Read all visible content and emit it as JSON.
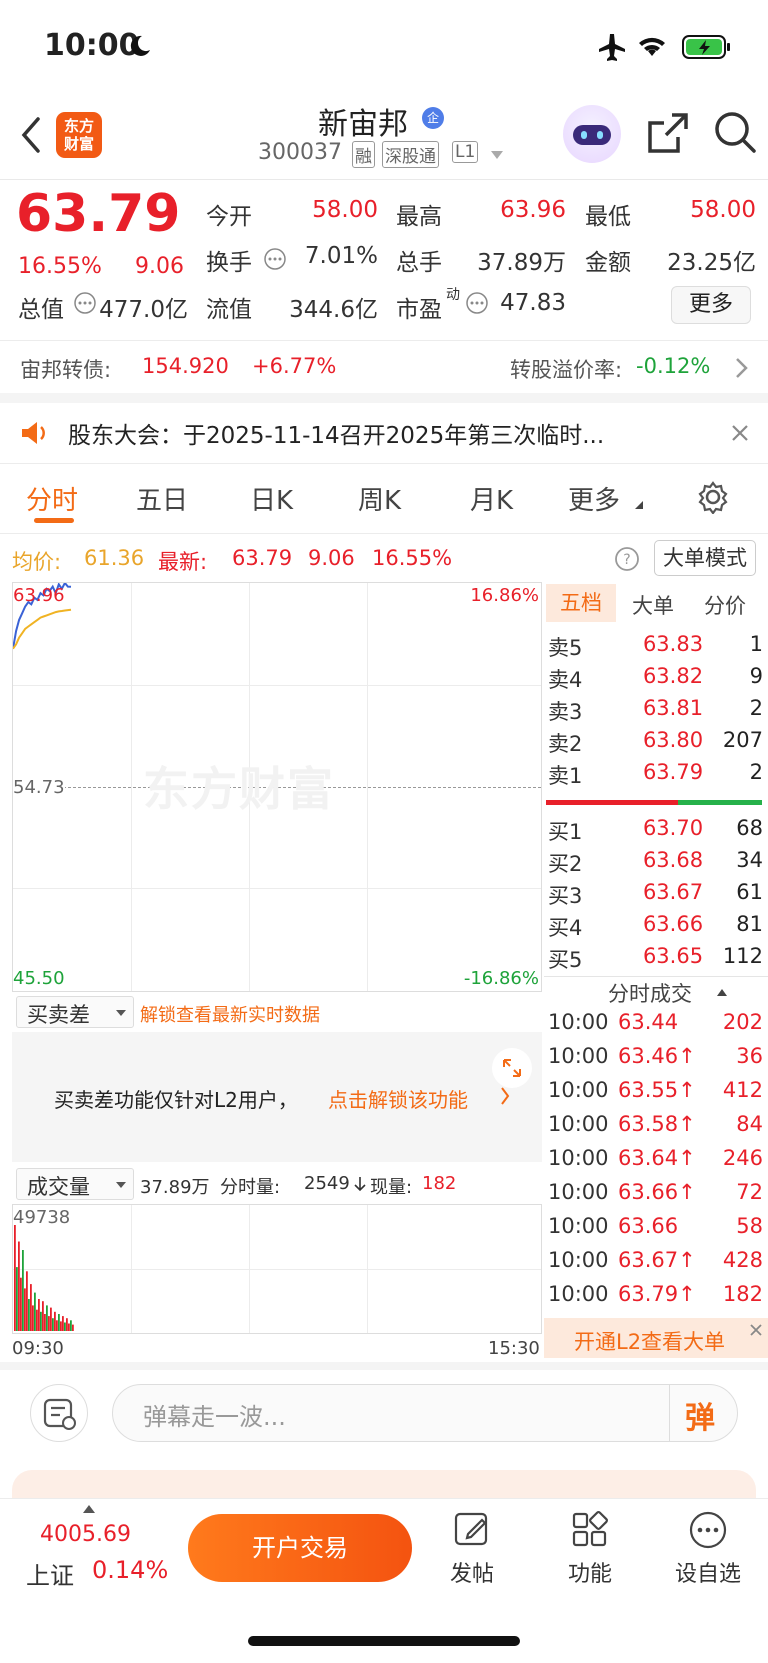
{
  "status": {
    "time": "10:00"
  },
  "header": {
    "logo_line1": "东方",
    "logo_line2": "财富",
    "stock_name": "新宙邦",
    "badge": "企",
    "code": "300037",
    "tag1": "融",
    "tag2": "深股通",
    "tag3": "L1"
  },
  "quote": {
    "price": "63.79",
    "pct": "16.55%",
    "change": "9.06",
    "open_label": "今开",
    "open": "58.00",
    "high_label": "最高",
    "high": "63.96",
    "low_label": "最低",
    "low": "58.00",
    "turnover_label": "换手",
    "turnover": "7.01%",
    "vol_label": "总手",
    "vol": "37.89万",
    "amount_label": "金额",
    "amount": "23.25亿",
    "mcap_label": "总值",
    "mcap": "477.0亿",
    "float_label": "流值",
    "float": "344.6亿",
    "pe_label": "市盈",
    "pe_sup": "动",
    "pe": "47.83",
    "more": "更多"
  },
  "bond": {
    "label": "宙邦转债:",
    "price": "154.920",
    "pct": "+6.77%",
    "premium_label": "转股溢价率:",
    "premium": "-0.12%"
  },
  "notice": {
    "text": "股东大会：于2025-11-14召开2025年第三次临时..."
  },
  "tabs": [
    "分时",
    "五日",
    "日K",
    "周K",
    "月K",
    "更多"
  ],
  "chart_header": {
    "avg_label": "均价:",
    "avg": "61.36",
    "latest_label": "最新:",
    "latest": "63.79",
    "chg": "9.06",
    "pct": "16.55%",
    "mode": "大单模式"
  },
  "chart_axis": {
    "top": "63.96",
    "mid": "54.73",
    "bottom": "45.50",
    "top_pct": "16.86%",
    "bottom_pct": "-16.86%",
    "watermark": "东方财富",
    "time_start": "09:30",
    "time_end": "15:30"
  },
  "chart_data": {
    "type": "line",
    "series": [
      {
        "values": [
          61.0,
          61.8,
          62.3,
          62.6,
          62.9,
          63.1,
          63.0,
          63.3,
          63.2,
          63.5,
          63.4,
          63.7,
          63.6,
          63.8,
          63.5,
          63.9,
          63.7,
          63.96,
          63.8,
          63.79
        ]
      },
      {
        "values": [
          61.0,
          61.2,
          61.5,
          61.7,
          61.9,
          62.0,
          62.1,
          62.2,
          62.3,
          62.4,
          62.45,
          62.5,
          62.55,
          62.6,
          62.65,
          62.68,
          62.7,
          62.72,
          62.74,
          62.76
        ]
      }
    ],
    "ylim": [
      45.5,
      63.96
    ]
  },
  "volume_data": {
    "max_label": "49738",
    "bars": [
      49738,
      30000,
      42000,
      25000,
      38000,
      20000,
      28000,
      15000,
      22000,
      12000,
      18000,
      10000,
      15000,
      9000,
      14000,
      8000,
      12000,
      7000,
      11000,
      6000,
      9000,
      5000,
      8000,
      4500,
      7000,
      4000,
      6000,
      3500,
      5000,
      3000
    ]
  },
  "bidask_tabs": [
    "五档",
    "大单",
    "分价"
  ],
  "sells": [
    {
      "label": "卖5",
      "price": "63.83",
      "vol": "1"
    },
    {
      "label": "卖4",
      "price": "63.82",
      "vol": "9"
    },
    {
      "label": "卖3",
      "price": "63.81",
      "vol": "2"
    },
    {
      "label": "卖2",
      "price": "63.80",
      "vol": "207"
    },
    {
      "label": "卖1",
      "price": "63.79",
      "vol": "2"
    }
  ],
  "buys": [
    {
      "label": "买1",
      "price": "63.70",
      "vol": "68"
    },
    {
      "label": "买2",
      "price": "63.68",
      "vol": "34"
    },
    {
      "label": "买3",
      "price": "63.67",
      "vol": "61"
    },
    {
      "label": "买4",
      "price": "63.66",
      "vol": "81"
    },
    {
      "label": "买5",
      "price": "63.65",
      "vol": "112"
    }
  ],
  "trades_title": "分时成交",
  "trades": [
    {
      "t": "10:00",
      "p": "63.44",
      "v": "202"
    },
    {
      "t": "10:00",
      "p": "63.46↑",
      "v": "36"
    },
    {
      "t": "10:00",
      "p": "63.55↑",
      "v": "412"
    },
    {
      "t": "10:00",
      "p": "63.58↑",
      "v": "84"
    },
    {
      "t": "10:00",
      "p": "63.64↑",
      "v": "246"
    },
    {
      "t": "10:00",
      "p": "63.66↑",
      "v": "72"
    },
    {
      "t": "10:00",
      "p": "63.66",
      "v": "58"
    },
    {
      "t": "10:00",
      "p": "63.67↑",
      "v": "428"
    },
    {
      "t": "10:00",
      "p": "63.79↑",
      "v": "182"
    }
  ],
  "l2_banner": "开通L2查看大单",
  "spread": {
    "label": "买卖差",
    "unlock": "解锁查看最新实时数据",
    "msg": "买卖差功能仅针对L2用户，",
    "link": "点击解锁该功能"
  },
  "volume_header": {
    "label": "成交量",
    "total": "37.89万",
    "period_label": "分时量:",
    "period": "2549",
    "now_label": "现量:",
    "now": "182"
  },
  "danmu": {
    "placeholder": "弹幕走一波...",
    "btn": "弹"
  },
  "bottom": {
    "index_val": "4005.69",
    "index_name": "上证",
    "index_pct": "0.14%",
    "trade_btn": "开户交易",
    "post": "发帖",
    "func": "功能",
    "watch": "设自选"
  }
}
